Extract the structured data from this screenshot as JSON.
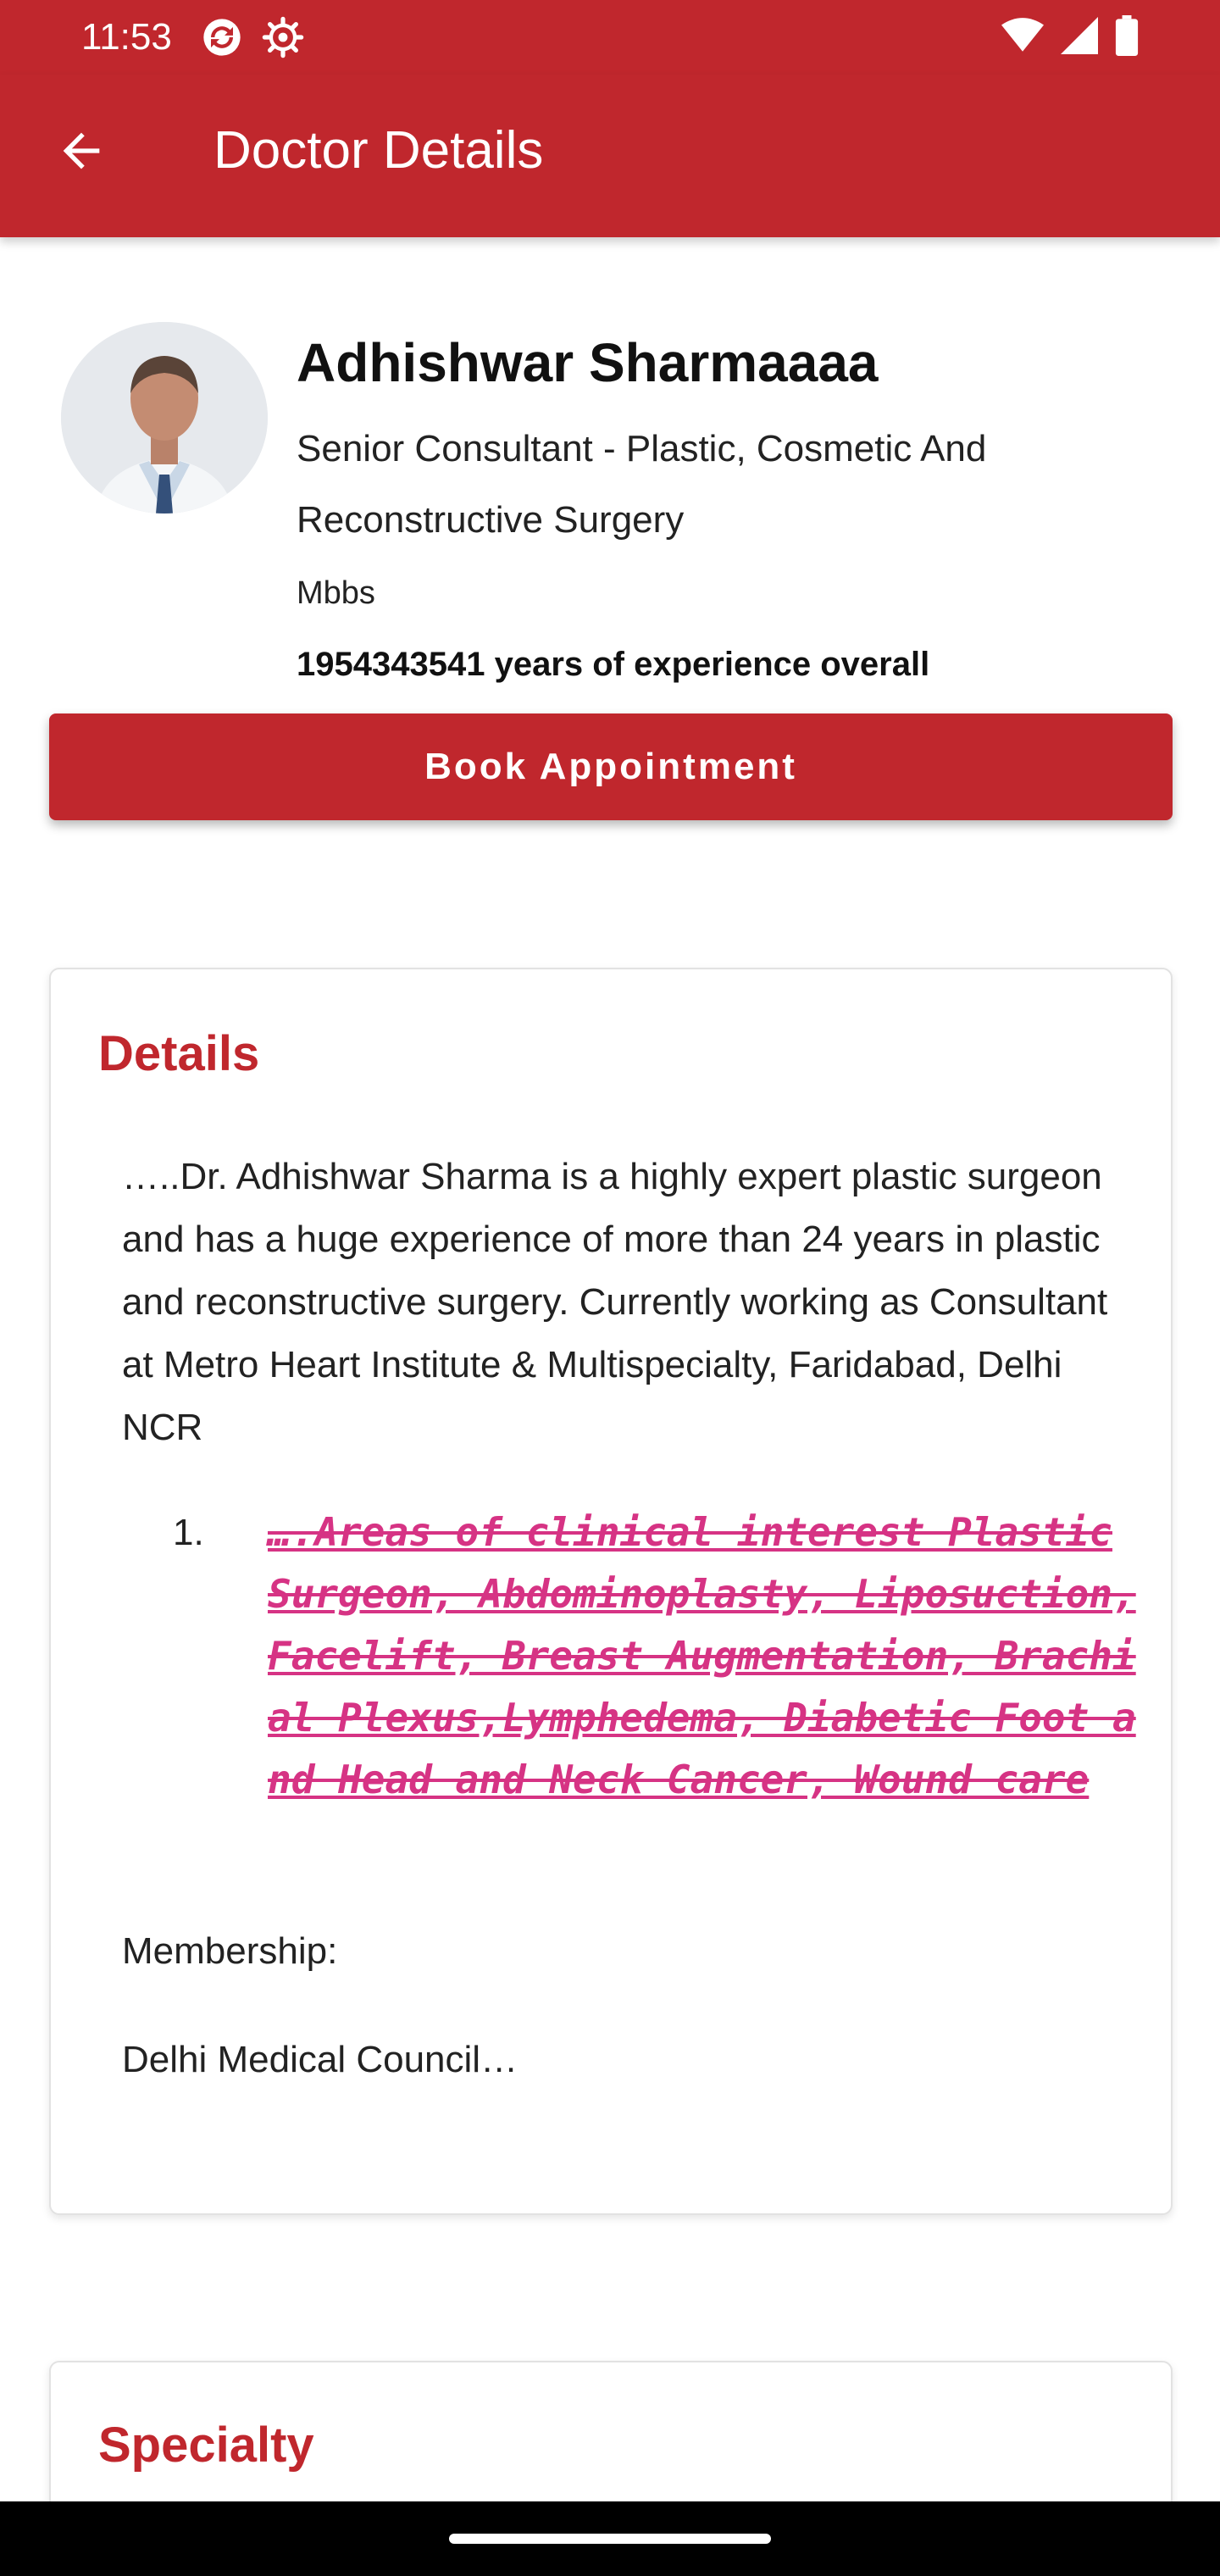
{
  "status_bar": {
    "time": "11:53",
    "left_icons": [
      "sync-icon",
      "gear-icon"
    ],
    "right_icons": [
      "wifi-icon",
      "signal-icon",
      "battery-icon"
    ]
  },
  "app_bar": {
    "title": "Doctor Details",
    "back_icon": "arrow-left-icon",
    "color": "#c0272d"
  },
  "doctor": {
    "name": "Adhishwar Sharmaaaa",
    "designation": "Senior Consultant - Plastic, Cosmetic And Reconstructive Surgery",
    "degree": "Mbbs",
    "experience": "1954343541 years of experience overall"
  },
  "book_button": {
    "label": "Book Appointment"
  },
  "details": {
    "heading": "Details",
    "paragraph": "…..Dr. Adhishwar Sharma is a highly expert plastic surgeon and has a huge experience of more than 24 years in plastic and reconstructive surgery. Currently working as Consultant at Metro Heart Institute & Multispecialty, Faridabad, Delhi NCR",
    "list_number": "1.",
    "clinical_interest": "….Areas of clinical interest Plastic Surgeon, Abdominoplasty, Liposuction, Facelift, Breast Augmentation, Brachial Plexus,Lymphedema, Diabetic Foot and Head and Neck Cancer, Wound care",
    "membership_label": "Membership:",
    "membership_value": "Delhi Medical Council…"
  },
  "specialty": {
    "heading": "Specialty"
  },
  "colors": {
    "accent": "#c0272d",
    "clinical_text": "#d63384"
  }
}
